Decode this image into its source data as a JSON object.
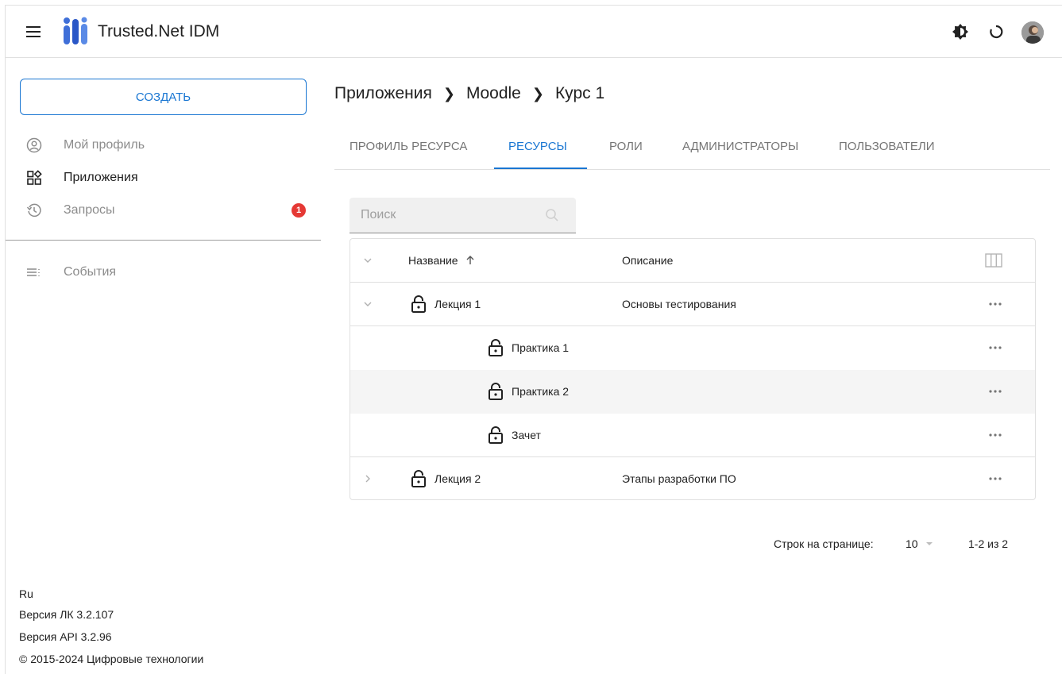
{
  "header": {
    "app_title": "Trusted.Net IDM"
  },
  "sidebar": {
    "create_label": "СОЗДАТЬ",
    "items": [
      {
        "label": "Мой профиль",
        "icon": "account-circle-icon"
      },
      {
        "label": "Приложения",
        "icon": "apps-icon"
      },
      {
        "label": "Запросы",
        "icon": "history-icon",
        "badge": "1"
      },
      {
        "label": "События",
        "icon": "event-list-icon"
      }
    ],
    "footer": {
      "lang": "Ru",
      "version_lk": "Версия ЛК 3.2.107",
      "version_api": "Версия API 3.2.96",
      "copyright": "© 2015-2024 Цифровые технологии"
    }
  },
  "breadcrumb": [
    "Приложения",
    "Moodle",
    "Курс 1"
  ],
  "tabs": [
    "ПРОФИЛЬ РЕСУРСА",
    "РЕСУРСЫ",
    "РОЛИ",
    "АДМИНИСТРАТОРЫ",
    "ПОЛЬЗОВАТЕЛИ"
  ],
  "active_tab": "РЕСУРСЫ",
  "search": {
    "placeholder": "Поиск"
  },
  "table": {
    "columns": {
      "name": "Название",
      "description": "Описание"
    },
    "rows": [
      {
        "name": "Лекция 1",
        "description": "Основы тестирования",
        "level": 0,
        "expanded": true
      },
      {
        "name": "Практика 1",
        "description": "",
        "level": 1
      },
      {
        "name": "Практика 2",
        "description": "",
        "level": 1
      },
      {
        "name": "Зачет",
        "description": "",
        "level": 1
      },
      {
        "name": "Лекция 2",
        "description": "Этапы разработки ПО",
        "level": 0,
        "expanded": false
      }
    ]
  },
  "pagination": {
    "rows_per_page_label": "Строк на странице:",
    "rows_per_page": "10",
    "range": "1-2 из 2"
  },
  "colors": {
    "accent": "#1976d2",
    "badge": "#e53935"
  }
}
